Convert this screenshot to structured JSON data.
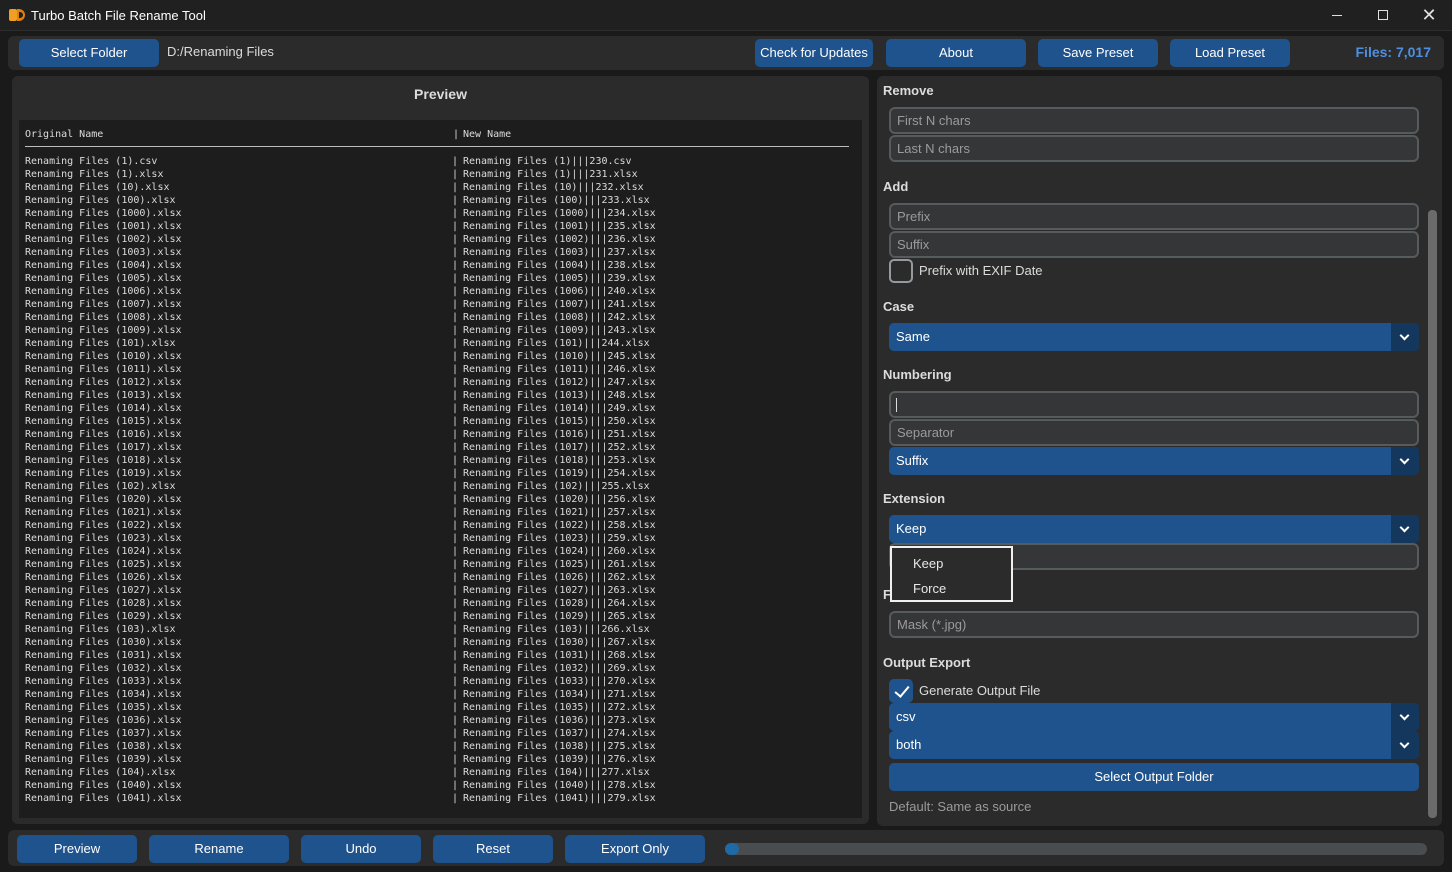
{
  "window": {
    "title": "Turbo Batch File Rename Tool",
    "close_glyph": "✕"
  },
  "toolbar": {
    "select_folder": "Select Folder",
    "folder_path": "D:/Renaming Files",
    "check_updates": "Check for Updates",
    "about": "About",
    "save_preset": "Save Preset",
    "load_preset": "Load Preset",
    "files_count": "Files: 7,017"
  },
  "preview": {
    "title": "Preview",
    "col_original": "Original Name",
    "col_new": "New Name",
    "rows": [
      [
        "Renaming Files (1).csv",
        "Renaming Files (1)|||230.csv"
      ],
      [
        "Renaming Files (1).xlsx",
        "Renaming Files (1)|||231.xlsx"
      ],
      [
        "Renaming Files (10).xlsx",
        "Renaming Files (10)|||232.xlsx"
      ],
      [
        "Renaming Files (100).xlsx",
        "Renaming Files (100)|||233.xlsx"
      ],
      [
        "Renaming Files (1000).xlsx",
        "Renaming Files (1000)|||234.xlsx"
      ],
      [
        "Renaming Files (1001).xlsx",
        "Renaming Files (1001)|||235.xlsx"
      ],
      [
        "Renaming Files (1002).xlsx",
        "Renaming Files (1002)|||236.xlsx"
      ],
      [
        "Renaming Files (1003).xlsx",
        "Renaming Files (1003)|||237.xlsx"
      ],
      [
        "Renaming Files (1004).xlsx",
        "Renaming Files (1004)|||238.xlsx"
      ],
      [
        "Renaming Files (1005).xlsx",
        "Renaming Files (1005)|||239.xlsx"
      ],
      [
        "Renaming Files (1006).xlsx",
        "Renaming Files (1006)|||240.xlsx"
      ],
      [
        "Renaming Files (1007).xlsx",
        "Renaming Files (1007)|||241.xlsx"
      ],
      [
        "Renaming Files (1008).xlsx",
        "Renaming Files (1008)|||242.xlsx"
      ],
      [
        "Renaming Files (1009).xlsx",
        "Renaming Files (1009)|||243.xlsx"
      ],
      [
        "Renaming Files (101).xlsx",
        "Renaming Files (101)|||244.xlsx"
      ],
      [
        "Renaming Files (1010).xlsx",
        "Renaming Files (1010)|||245.xlsx"
      ],
      [
        "Renaming Files (1011).xlsx",
        "Renaming Files (1011)|||246.xlsx"
      ],
      [
        "Renaming Files (1012).xlsx",
        "Renaming Files (1012)|||247.xlsx"
      ],
      [
        "Renaming Files (1013).xlsx",
        "Renaming Files (1013)|||248.xlsx"
      ],
      [
        "Renaming Files (1014).xlsx",
        "Renaming Files (1014)|||249.xlsx"
      ],
      [
        "Renaming Files (1015).xlsx",
        "Renaming Files (1015)|||250.xlsx"
      ],
      [
        "Renaming Files (1016).xlsx",
        "Renaming Files (1016)|||251.xlsx"
      ],
      [
        "Renaming Files (1017).xlsx",
        "Renaming Files (1017)|||252.xlsx"
      ],
      [
        "Renaming Files (1018).xlsx",
        "Renaming Files (1018)|||253.xlsx"
      ],
      [
        "Renaming Files (1019).xlsx",
        "Renaming Files (1019)|||254.xlsx"
      ],
      [
        "Renaming Files (102).xlsx",
        "Renaming Files (102)|||255.xlsx"
      ],
      [
        "Renaming Files (1020).xlsx",
        "Renaming Files (1020)|||256.xlsx"
      ],
      [
        "Renaming Files (1021).xlsx",
        "Renaming Files (1021)|||257.xlsx"
      ],
      [
        "Renaming Files (1022).xlsx",
        "Renaming Files (1022)|||258.xlsx"
      ],
      [
        "Renaming Files (1023).xlsx",
        "Renaming Files (1023)|||259.xlsx"
      ],
      [
        "Renaming Files (1024).xlsx",
        "Renaming Files (1024)|||260.xlsx"
      ],
      [
        "Renaming Files (1025).xlsx",
        "Renaming Files (1025)|||261.xlsx"
      ],
      [
        "Renaming Files (1026).xlsx",
        "Renaming Files (1026)|||262.xlsx"
      ],
      [
        "Renaming Files (1027).xlsx",
        "Renaming Files (1027)|||263.xlsx"
      ],
      [
        "Renaming Files (1028).xlsx",
        "Renaming Files (1028)|||264.xlsx"
      ],
      [
        "Renaming Files (1029).xlsx",
        "Renaming Files (1029)|||265.xlsx"
      ],
      [
        "Renaming Files (103).xlsx",
        "Renaming Files (103)|||266.xlsx"
      ],
      [
        "Renaming Files (1030).xlsx",
        "Renaming Files (1030)|||267.xlsx"
      ],
      [
        "Renaming Files (1031).xlsx",
        "Renaming Files (1031)|||268.xlsx"
      ],
      [
        "Renaming Files (1032).xlsx",
        "Renaming Files (1032)|||269.xlsx"
      ],
      [
        "Renaming Files (1033).xlsx",
        "Renaming Files (1033)|||270.xlsx"
      ],
      [
        "Renaming Files (1034).xlsx",
        "Renaming Files (1034)|||271.xlsx"
      ],
      [
        "Renaming Files (1035).xlsx",
        "Renaming Files (1035)|||272.xlsx"
      ],
      [
        "Renaming Files (1036).xlsx",
        "Renaming Files (1036)|||273.xlsx"
      ],
      [
        "Renaming Files (1037).xlsx",
        "Renaming Files (1037)|||274.xlsx"
      ],
      [
        "Renaming Files (1038).xlsx",
        "Renaming Files (1038)|||275.xlsx"
      ],
      [
        "Renaming Files (1039).xlsx",
        "Renaming Files (1039)|||276.xlsx"
      ],
      [
        "Renaming Files (104).xlsx",
        "Renaming Files (104)|||277.xlsx"
      ],
      [
        "Renaming Files (1040).xlsx",
        "Renaming Files (1040)|||278.xlsx"
      ],
      [
        "Renaming Files (1041).xlsx",
        "Renaming Files (1041)|||279.xlsx"
      ]
    ]
  },
  "options": {
    "remove": {
      "label": "Remove",
      "first_placeholder": "First N chars",
      "last_placeholder": "Last N chars"
    },
    "add": {
      "label": "Add",
      "prefix_placeholder": "Prefix",
      "suffix_placeholder": "Suffix",
      "exif_label": "Prefix with EXIF Date",
      "exif_checked": false
    },
    "case": {
      "label": "Case",
      "value": "Same"
    },
    "numbering": {
      "label": "Numbering",
      "start_value": "",
      "separator_placeholder": "Separator",
      "position": "Suffix"
    },
    "extension": {
      "label": "Extension",
      "value": "Keep",
      "options": [
        "Keep",
        "Force"
      ]
    },
    "filter": {
      "label_partial": "F",
      "mask_placeholder": "Mask (*.jpg)"
    },
    "output": {
      "label": "Output Export",
      "generate_label": "Generate Output File",
      "generate_checked": true,
      "format": "csv",
      "mode": "both",
      "select_folder": "Select Output Folder",
      "default_hint": "Default: Same as source"
    }
  },
  "actions": {
    "preview": "Preview",
    "rename": "Rename",
    "undo": "Undo",
    "reset": "Reset",
    "export_only": "Export Only",
    "progress": 0.02
  },
  "colors": {
    "accent": "#1f538d",
    "count_text": "#4f8fe0",
    "panel": "#2b2b2b",
    "background": "#1a1a1a"
  }
}
